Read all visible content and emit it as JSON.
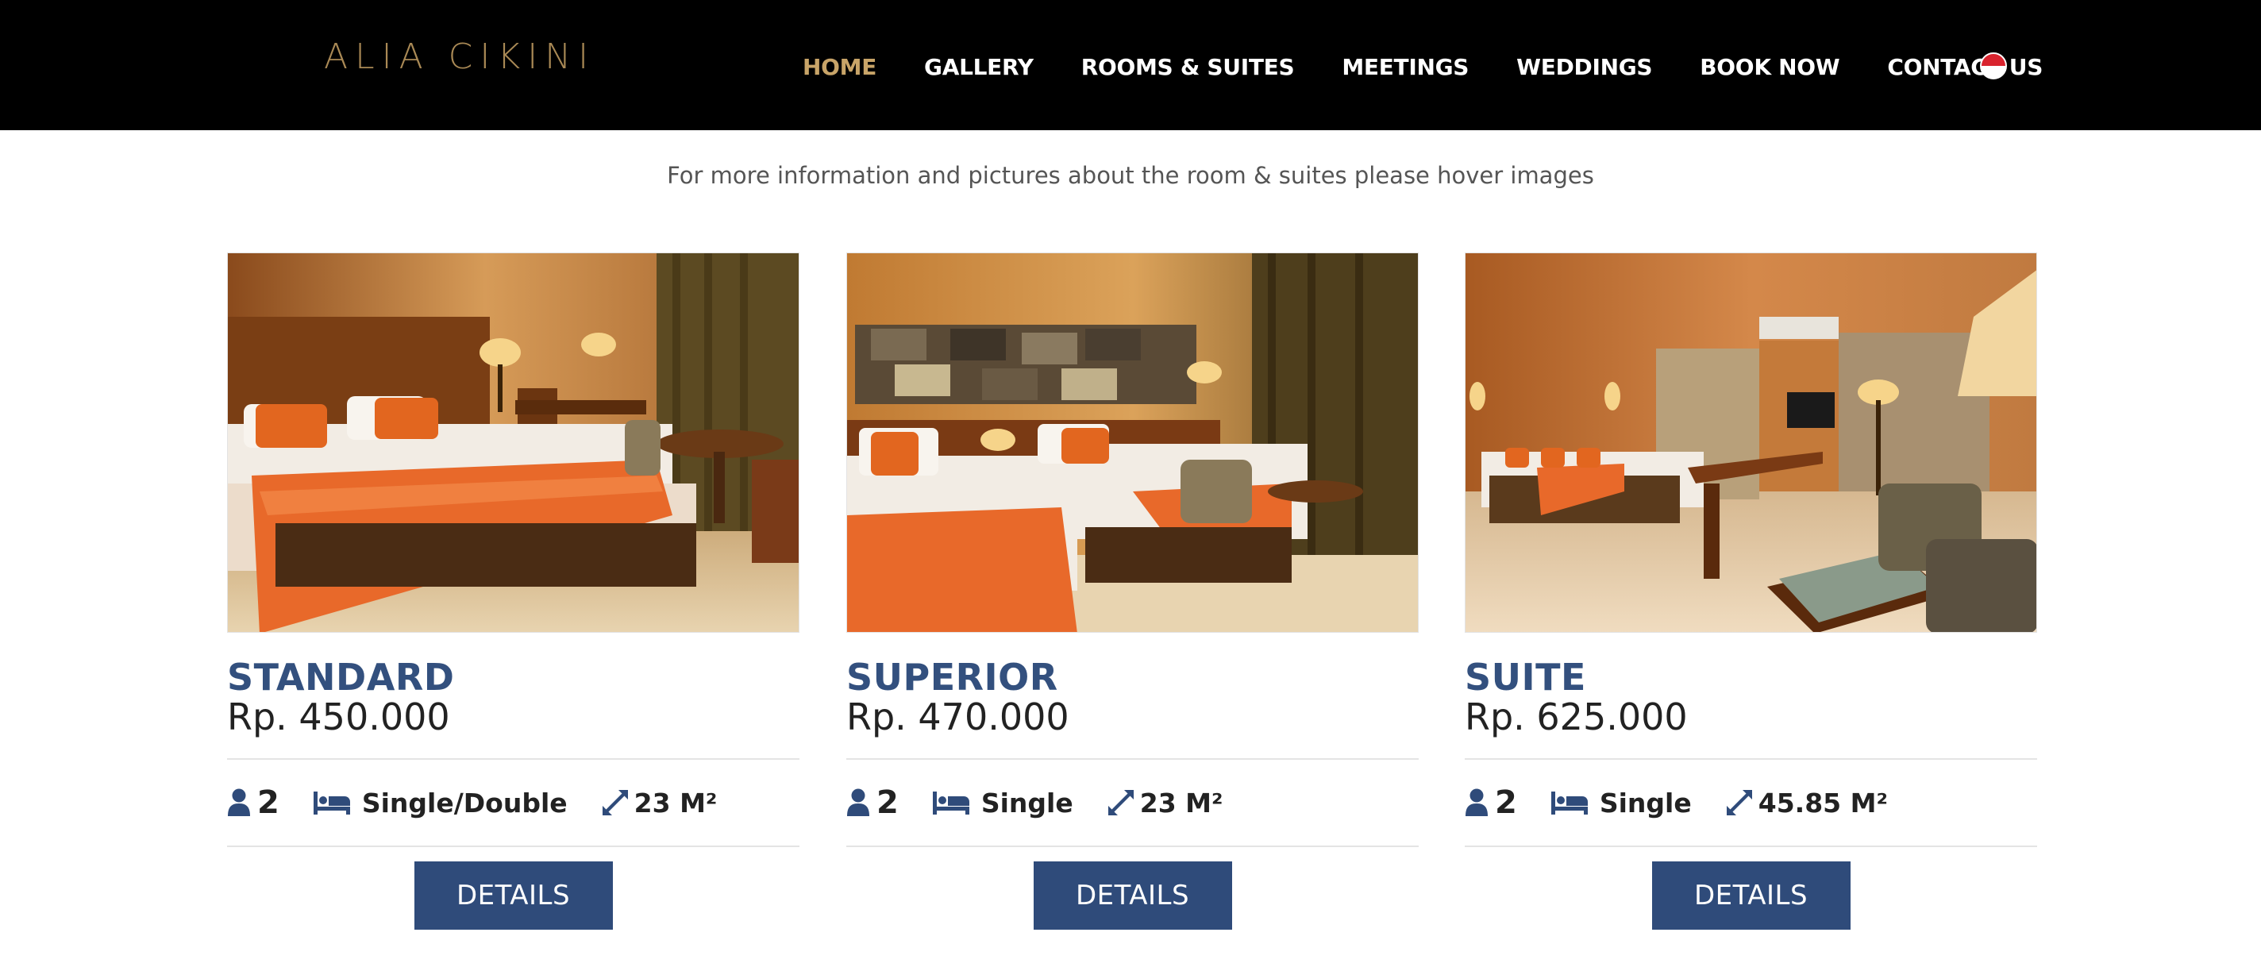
{
  "site": {
    "logo_text": "ALIA CIKINI",
    "brand_color": "#a98955",
    "nav_active_color": "#c8a468",
    "accent_color": "#2f4b7a"
  },
  "nav": {
    "items": [
      {
        "label": "HOME",
        "active": true
      },
      {
        "label": "GALLERY"
      },
      {
        "label": "ROOMS & SUITES"
      },
      {
        "label": "MEETINGS"
      },
      {
        "label": "WEDDINGS"
      },
      {
        "label": "BOOK NOW"
      },
      {
        "label": "CONTACT US"
      }
    ],
    "language_flag": "indonesia-flag-icon"
  },
  "intro": "For more information and pictures about the room & suites please hover images",
  "rooms": [
    {
      "title": "STANDARD",
      "price": "Rp. 450.000",
      "persons": "2",
      "beds": "Single/Double",
      "area": "23 M²",
      "details_label": "DETAILS"
    },
    {
      "title": "SUPERIOR",
      "price": "Rp. 470.000",
      "persons": "2",
      "beds": "Single",
      "area": "23 M²",
      "details_label": "DETAILS"
    },
    {
      "title": "SUITE",
      "price": "Rp. 625.000",
      "persons": "2",
      "beds": "Single",
      "area": "45.85 M²",
      "details_label": "DETAILS"
    }
  ]
}
